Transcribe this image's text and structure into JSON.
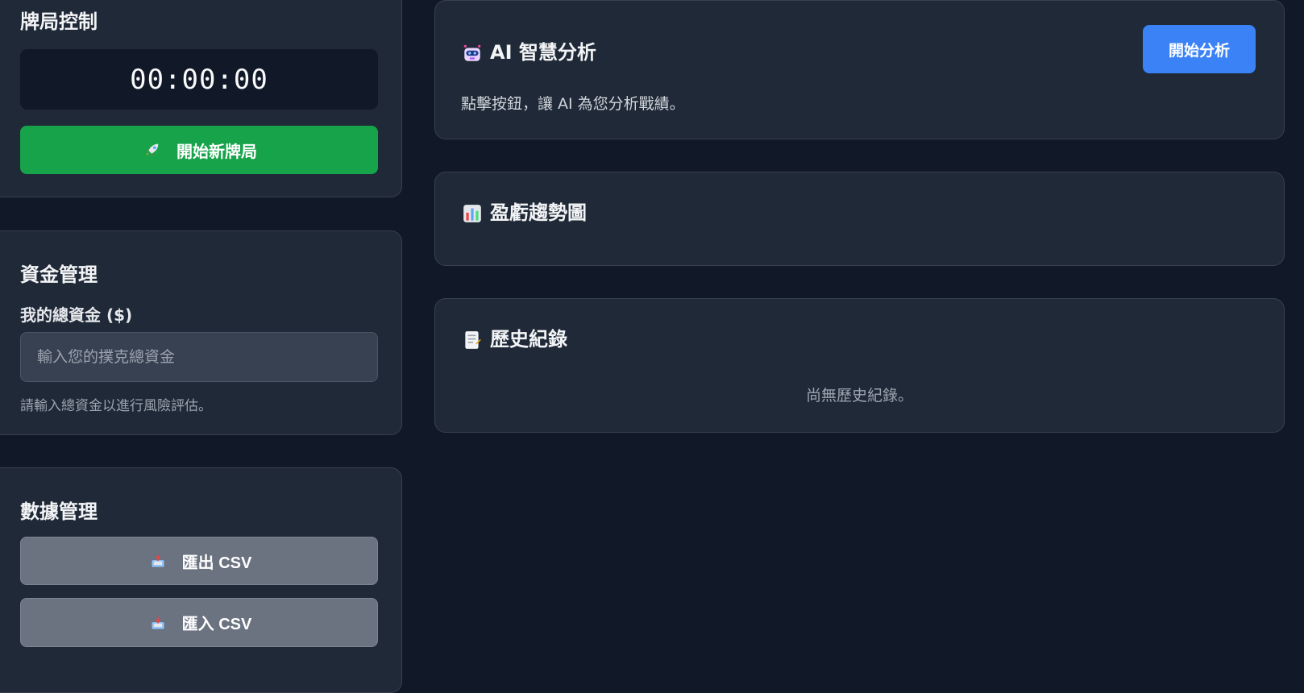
{
  "game_control": {
    "title": "牌局控制",
    "timer": "00:00:00",
    "start_button": "開始新牌局",
    "start_icon": "rocket-icon"
  },
  "funds": {
    "title": "資金管理",
    "label": "我的總資金 ($)",
    "placeholder": "輸入您的撲克總資金",
    "hint": "請輸入總資金以進行風險評估。"
  },
  "data_mgmt": {
    "title": "數據管理",
    "export_button": "匯出 CSV",
    "import_button": "匯入 CSV",
    "export_icon": "outbox-tray-icon",
    "import_icon": "inbox-tray-icon"
  },
  "ai_analysis": {
    "title": "AI 智慧分析",
    "icon": "robot-icon",
    "button": "開始分析",
    "description": "點擊按鈕，讓 AI 為您分析戰績。"
  },
  "trend_chart": {
    "title": "盈虧趨勢圖",
    "icon": "bar-chart-icon"
  },
  "history": {
    "title": "歷史紀錄",
    "icon": "memo-icon",
    "empty": "尚無歷史紀錄。"
  },
  "colors": {
    "background": "#111827",
    "card": "#1f2937",
    "green": "#16a34a",
    "blue": "#3b82f6",
    "gray_button": "#6b7280"
  }
}
